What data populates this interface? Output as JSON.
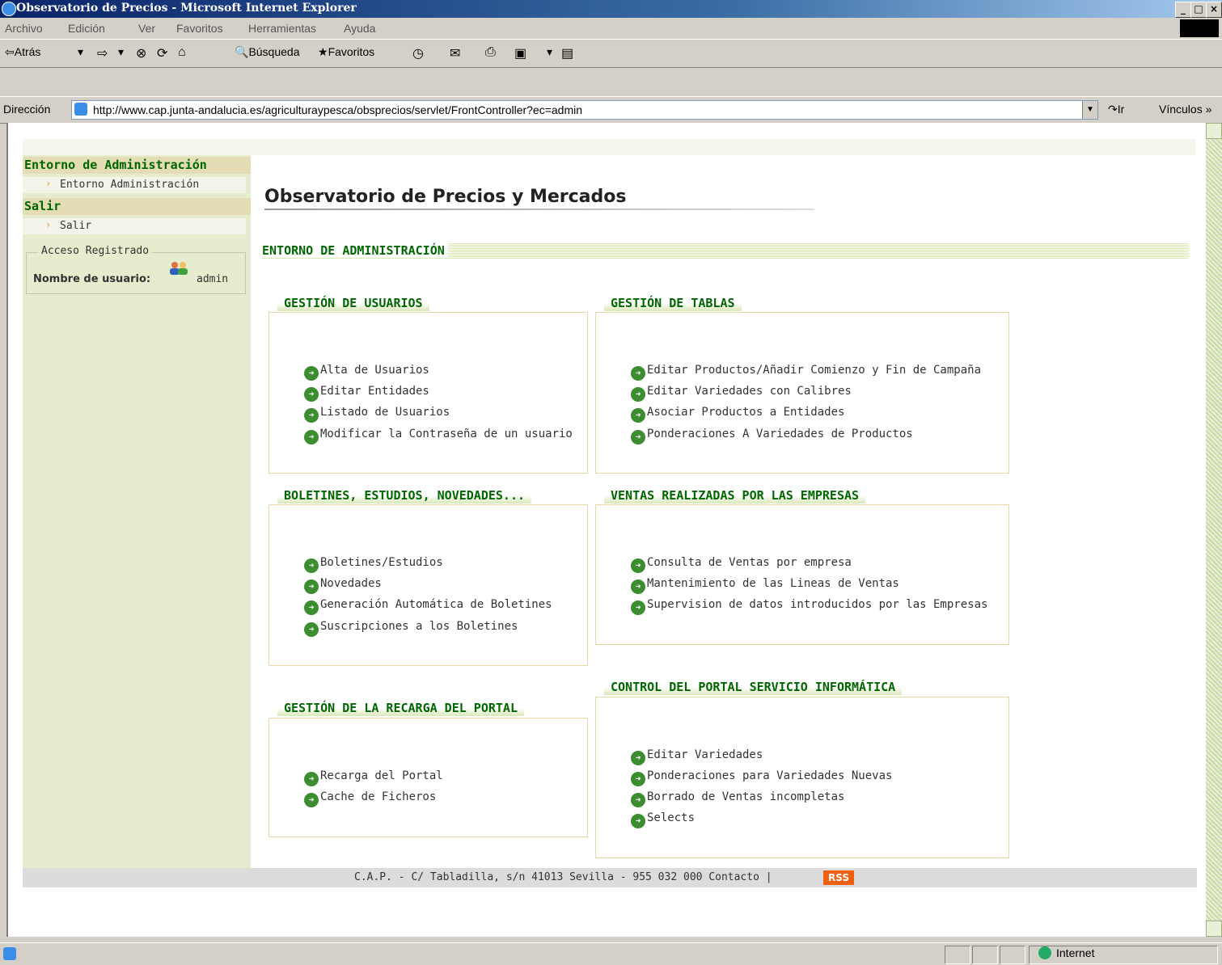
{
  "window": {
    "title": "Observatorio de Precios - Microsoft Internet Explorer",
    "controls": [
      "_",
      "□",
      "×"
    ]
  },
  "menu": [
    "Archivo",
    "Edición",
    "Ver",
    "Favoritos",
    "Herramientas",
    "Ayuda"
  ],
  "toolbar": {
    "back": "⇦Atrás",
    "search": "Búsqueda",
    "favorites": "Favoritos"
  },
  "address": {
    "label": "Dirección",
    "url": "http://www.cap.junta-andalucia.es/agriculturaypesca/obsprecios/servlet/FrontController?ec=admin",
    "go": "Ir",
    "links": "Vínculos »"
  },
  "sidebar": {
    "section1": "Entorno de Administración",
    "item1": "Entorno Administración",
    "section2": "Salir",
    "item2": "Salir",
    "legend": "Acceso Registrado",
    "user_label": "Nombre de usuario:",
    "user_name": "admin"
  },
  "page": {
    "title": "Observatorio de Precios y Mercados",
    "admin_heading": "ENTORNO DE ADMINISTRACIÓN"
  },
  "sections": {
    "usuarios": {
      "title": "GESTIÓN DE USUARIOS",
      "links": [
        "Alta de Usuarios",
        "Editar Entidades",
        "Listado de Usuarios",
        "Modificar la Contraseña de un usuario"
      ]
    },
    "tablas": {
      "title": "GESTIÓN DE TABLAS",
      "links": [
        "Editar Productos/Añadir Comienzo y Fin de Campaña",
        "Editar Variedades con Calibres",
        "Asociar Productos a Entidades",
        "Ponderaciones A Variedades de Productos"
      ]
    },
    "boletines": {
      "title": "BOLETINES, ESTUDIOS, NOVEDADES...",
      "links": [
        "Boletines/Estudios",
        "Novedades",
        "Generación Automática de Boletines",
        "Suscripciones a los Boletines"
      ]
    },
    "ventas": {
      "title": "VENTAS REALIZADAS POR LAS EMPRESAS",
      "links": [
        "Consulta de Ventas por empresa",
        "Mantenimiento de las Lineas de Ventas",
        "Supervision de datos introducidos por las Empresas"
      ]
    },
    "recarga": {
      "title": "GESTIÓN DE LA RECARGA DEL PORTAL",
      "links": [
        "Recarga del Portal",
        "Cache de Ficheros"
      ]
    },
    "control": {
      "title": "CONTROL DEL PORTAL SERVICIO INFORMÁTICA",
      "links": [
        "Editar Variedades",
        "Ponderaciones para Variedades Nuevas",
        "Borrado de Ventas incompletas",
        "Selects"
      ]
    }
  },
  "footer": {
    "text": "C.A.P. - C/ Tabladilla, s/n 41013 Sevilla - 955 032 000",
    "contact": "Contacto",
    "separator": "|",
    "rss": "RSS"
  },
  "status": {
    "zone": "Internet"
  }
}
